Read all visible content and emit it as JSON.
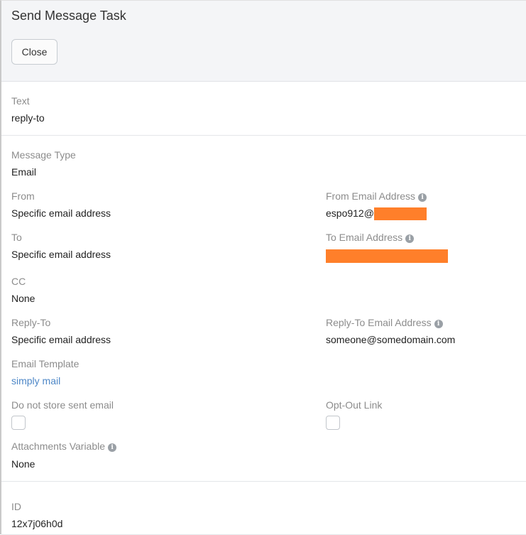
{
  "header": {
    "title": "Send Message Task",
    "close_label": "Close"
  },
  "text_section": {
    "label": "Text",
    "value": "reply-to"
  },
  "fields": {
    "message_type": {
      "label": "Message Type",
      "value": "Email"
    },
    "from": {
      "label": "From",
      "value": "Specific email address"
    },
    "from_email": {
      "label": "From Email Address",
      "value_prefix": "espo912@"
    },
    "to": {
      "label": "To",
      "value": "Specific email address"
    },
    "to_email": {
      "label": "To Email Address"
    },
    "cc": {
      "label": "CC",
      "value": "None"
    },
    "reply_to": {
      "label": "Reply-To",
      "value": "Specific email address"
    },
    "reply_to_email": {
      "label": "Reply-To Email Address",
      "value": "someone@somedomain.com"
    },
    "email_template": {
      "label": "Email Template",
      "value": "simply mail"
    },
    "do_not_store": {
      "label": "Do not store sent email",
      "checked": false
    },
    "opt_out": {
      "label": "Opt-Out Link",
      "checked": false
    },
    "attachments": {
      "label": "Attachments Variable",
      "value": "None"
    }
  },
  "id_section": {
    "label": "ID",
    "value": "12x7j06h0d"
  },
  "colors": {
    "redaction": "#ff7f2a",
    "link": "#4d87c7"
  },
  "icons": {
    "info": "info-icon"
  }
}
